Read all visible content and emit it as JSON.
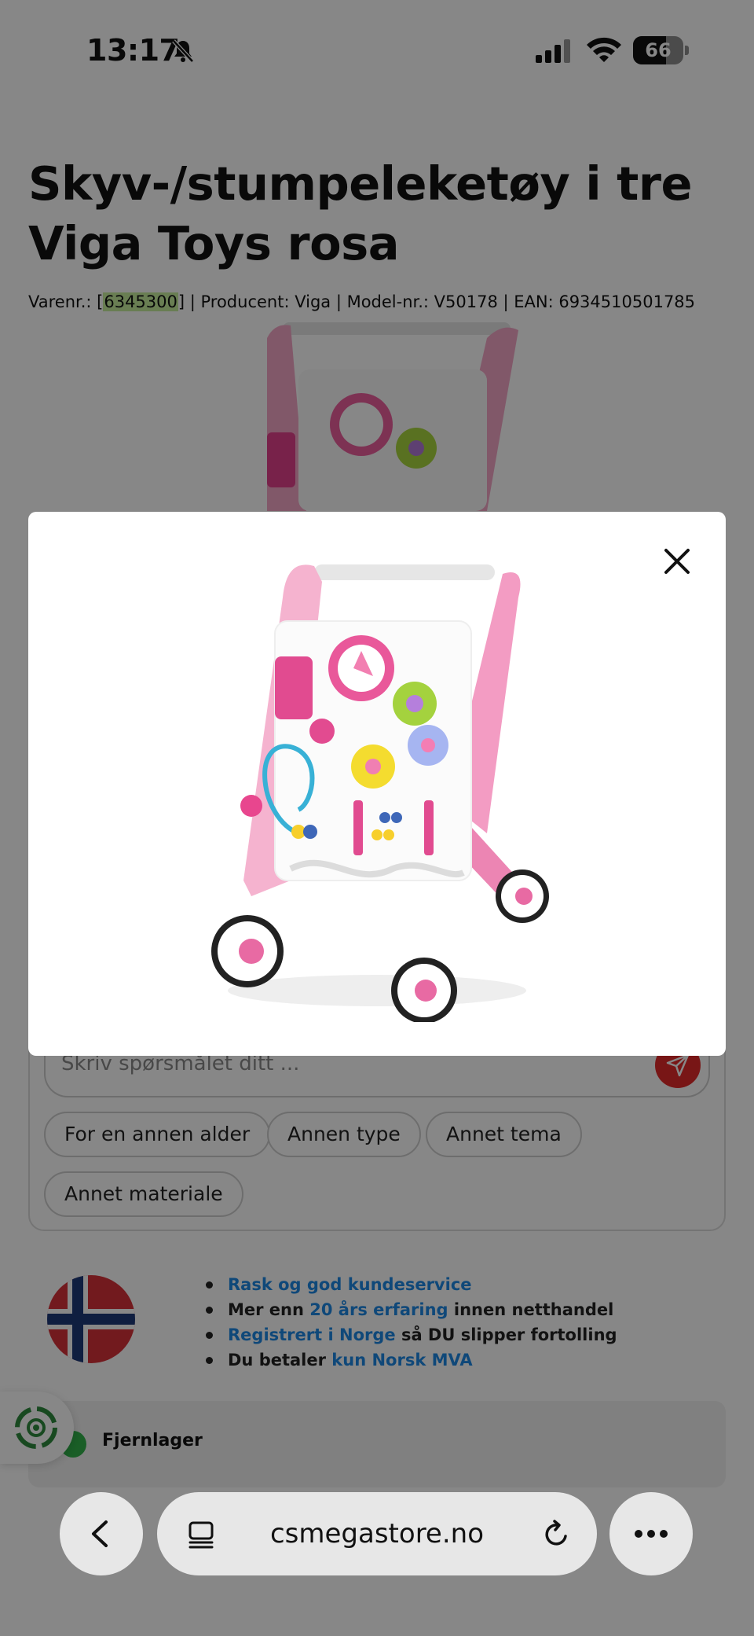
{
  "status_bar": {
    "time": "13:17",
    "battery_level": "66",
    "battery_fraction": 0.66,
    "icons": [
      "bell-slash-icon",
      "signal-icon",
      "wifi-icon",
      "battery-icon"
    ]
  },
  "product": {
    "title": "Skyv-/stumpeleketøy i tre Viga Toys rosa",
    "sku_label": "Varenr.: [",
    "sku": "6345300",
    "meta_rest": "] | Producent: Viga | Model-nr.: V50178 | EAN: 6934510501785"
  },
  "modal": {
    "close_icon": "close-icon"
  },
  "question": {
    "placeholder": "Skriv spørsmålet ditt ...",
    "chips": [
      "For en annen alder",
      "Annen type",
      "Annet tema",
      "Annet materiale"
    ]
  },
  "trust": {
    "items": [
      {
        "link": "Rask og god kundeservice",
        "pre": "",
        "post": ""
      },
      {
        "pre": "Mer enn ",
        "link": "20 års erfaring",
        "post": " innen netthandel"
      },
      {
        "pre": "",
        "link": "Registrert i Norge",
        "post": " så DU slipper fortolling"
      },
      {
        "pre": "Du betaler ",
        "link": "kun Norsk MVA",
        "post": ""
      }
    ]
  },
  "stock": {
    "label": "Fjernlager"
  },
  "browser": {
    "url": "csmegastore.no"
  },
  "colors": {
    "accent_link": "#1e88e5",
    "send_button": "#e32a2a",
    "highlight": "#c6ef9e",
    "stock_check": "#31b24a"
  }
}
